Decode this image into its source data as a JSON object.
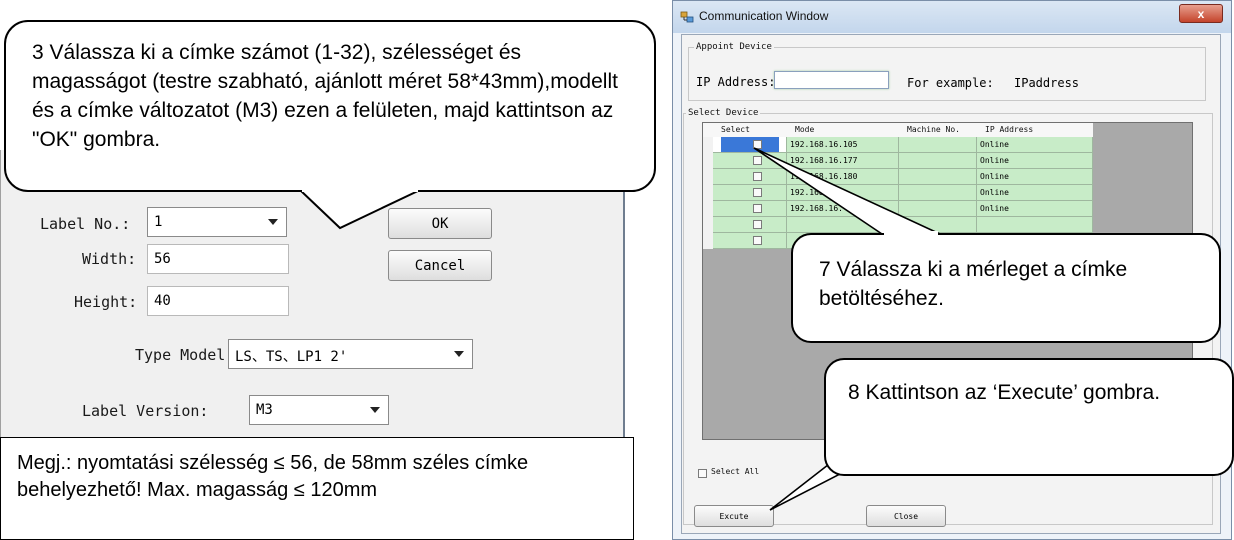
{
  "left_dialog": {
    "label_no_label": "Label No.:",
    "label_no_value": "1",
    "width_label": "Width:",
    "width_value": "56",
    "height_label": "Height:",
    "height_value": "40",
    "ok_label": "OK",
    "cancel_label": "Cancel",
    "type_model_label": "Type Model",
    "type_model_value": "LS、TS、LP1  2'",
    "label_version_label": "Label Version:",
    "label_version_value": "M3"
  },
  "callouts": {
    "step3": "3 Válassza ki a címke számot (1-32), szélességet és magasságot (testre szabható, ajánlott méret 58*43mm),modellt és a címke változatot (M3) ezen a felületen, majd kattintson az \"OK\" gombra.",
    "note": "Megj.: nyomtatási szélesség ≤ 56, de 58mm széles címke behelyezhető! Max. magasság ≤ 120mm",
    "step7": "7 Válassza ki a mérleget a címke betöltéséhez.",
    "step8": "8 Kattintson az ‘Execute’ gombra."
  },
  "comm_window": {
    "title": "Communication Window",
    "close_glyph": "x",
    "appoint_device": "Appoint Device",
    "ip_label": "IP Address:",
    "ip_value": "",
    "example_label": "For example:",
    "example_value": "IPaddress",
    "select_device": "Select Device",
    "columns": [
      "Select",
      "Mode",
      "Machine No.",
      "IP Address"
    ],
    "rows": [
      {
        "mode": "192.168.16.105",
        "machine": "",
        "ip": "Online"
      },
      {
        "mode": "192.168.16.177",
        "machine": "",
        "ip": "Online"
      },
      {
        "mode": "192.168.16.180",
        "machine": "",
        "ip": "Online"
      },
      {
        "mode": "192.168.16.",
        "machine": "",
        "ip": "Online"
      },
      {
        "mode": "192.168.16.",
        "machine": "",
        "ip": "Online"
      },
      {
        "mode": "",
        "machine": "",
        "ip": ""
      },
      {
        "mode": "",
        "machine": "",
        "ip": ""
      }
    ],
    "select_all": "Select All",
    "execute_label": "Excute",
    "close_label": "Close"
  },
  "colors": {
    "grid_row": "#c8ecc8",
    "grid_bg": "#a9a9a9",
    "selected_cell": "#3a78d8"
  }
}
